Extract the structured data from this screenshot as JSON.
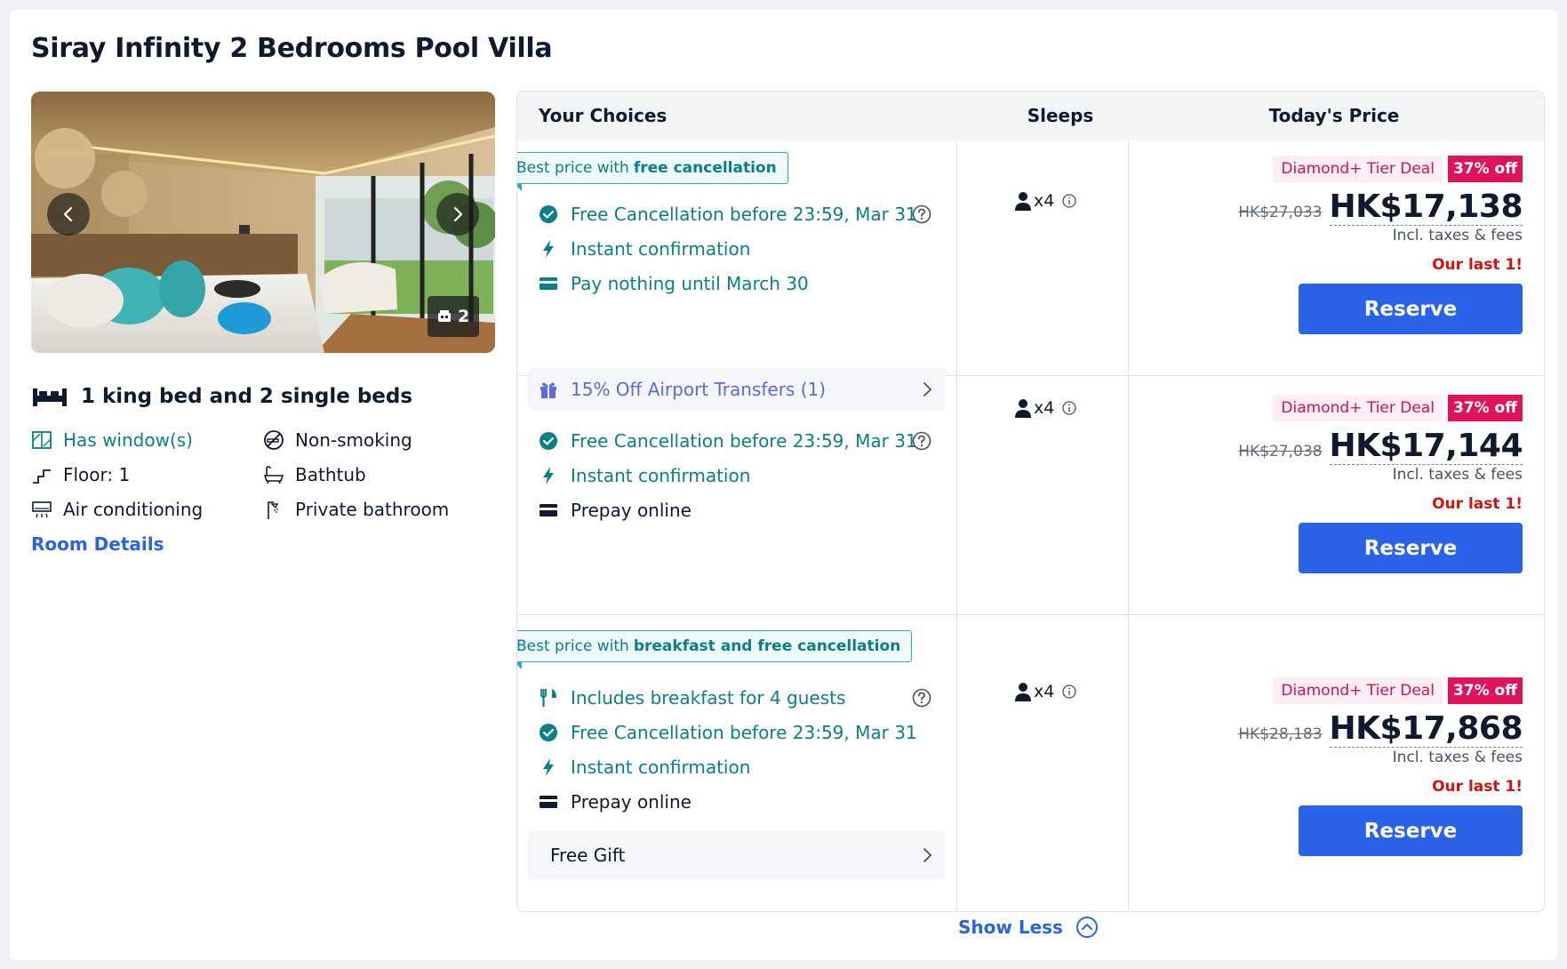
{
  "room": {
    "title": "Siray Infinity 2 Bedrooms Pool Villa",
    "photo_count": "2",
    "bed_info": "1 king bed and 2 single beds",
    "amenities": {
      "window": "Has window(s)",
      "non_smoking": "Non-smoking",
      "floor": "Floor: 1",
      "bathtub": "Bathtub",
      "air_conditioning": "Air conditioning",
      "private_bathroom": "Private bathroom"
    },
    "details_link": "Room Details"
  },
  "table": {
    "headers": {
      "choices": "Your Choices",
      "sleeps": "Sleeps",
      "price": "Today's Price"
    },
    "rows": [
      {
        "tag_prefix": "Best price with",
        "tag_bold": "free cancellation",
        "free_cancellation": "Free Cancellation before 23:59, Mar 31",
        "instant": "Instant confirmation",
        "payment": "Pay nothing until March 30",
        "sleeps": "x4",
        "deal_label": "Diamond+ Tier Deal",
        "deal_pct": "37% off",
        "original_price": "HK$27,033",
        "price": "HK$17,138",
        "incl": "Incl. taxes & fees",
        "last": "Our last 1!",
        "reserve": "Reserve"
      },
      {
        "promo": "15% Off Airport Transfers (1)",
        "free_cancellation": "Free Cancellation before 23:59, Mar 31",
        "instant": "Instant confirmation",
        "payment": "Prepay online",
        "sleeps": "x4",
        "deal_label": "Diamond+ Tier Deal",
        "deal_pct": "37% off",
        "original_price": "HK$27,038",
        "price": "HK$17,144",
        "incl": "Incl. taxes & fees",
        "last": "Our last 1!",
        "reserve": "Reserve"
      },
      {
        "tag_prefix": "Best price with",
        "tag_bold": "breakfast and free cancellation",
        "breakfast": "Includes breakfast for 4 guests",
        "free_cancellation": "Free Cancellation before 23:59, Mar 31",
        "instant": "Instant confirmation",
        "payment": "Prepay online",
        "gift": "Free Gift",
        "sleeps": "x4",
        "deal_label": "Diamond+ Tier Deal",
        "deal_pct": "37% off",
        "original_price": "HK$28,183",
        "price": "HK$17,868",
        "incl": "Incl. taxes & fees",
        "last": "Our last 1!",
        "reserve": "Reserve"
      }
    ]
  },
  "show_less": "Show Less",
  "colors": {
    "teal": "#0a7f86",
    "blue": "#2a63e8",
    "deal_pink": "#e0125c",
    "alert_red": "#d3130f"
  },
  "icons": [
    "chevron-left-icon",
    "chevron-right-icon",
    "photo-icon",
    "bed-icon",
    "window-icon",
    "no-smoking-icon",
    "stairs-icon",
    "bathtub-icon",
    "air-conditioner-icon",
    "shower-icon",
    "check-circle-icon",
    "lightning-icon",
    "card-icon",
    "help-icon",
    "gift-icon",
    "utensils-icon",
    "person-icon",
    "info-icon",
    "chevron-up-circle-icon"
  ]
}
